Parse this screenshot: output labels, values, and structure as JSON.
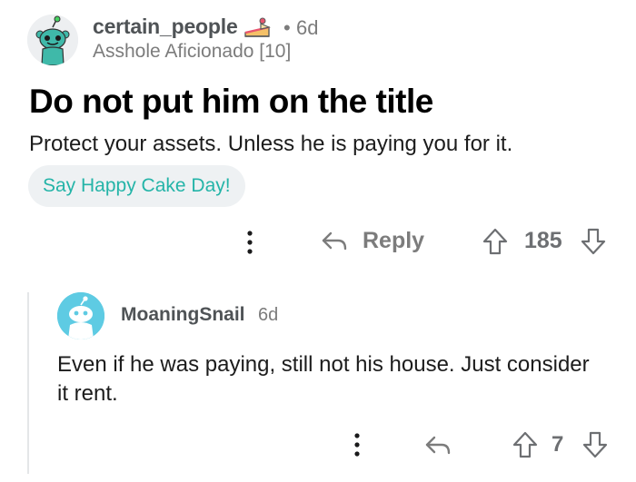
{
  "comment": {
    "username": "certain_people",
    "age": "6d",
    "dot": "•",
    "flair": "Asshole Aficionado [10]",
    "title": "Do not put him on the title",
    "body": "Protect your assets. Unless he is paying you for it.",
    "cake_day_button": "Say Happy Cake Day!",
    "actions": {
      "reply_label": "Reply",
      "score": "185"
    }
  },
  "reply": {
    "username": "MoaningSnail",
    "age": "6d",
    "body": "Even if he was paying, still not his house. Just consider it rent.",
    "actions": {
      "score": "7"
    }
  },
  "icons": {
    "cake": "cake-icon",
    "more": "more-vertical-icon",
    "reply": "reply-arrow-icon",
    "upvote": "upvote-arrow-icon",
    "downvote": "downvote-arrow-icon"
  },
  "colors": {
    "cake_day_text": "#24b4a8",
    "cake_day_bg": "#eef1f3",
    "avatar2_bg": "#5ecbe3",
    "meta_gray": "#7c7c7c"
  }
}
